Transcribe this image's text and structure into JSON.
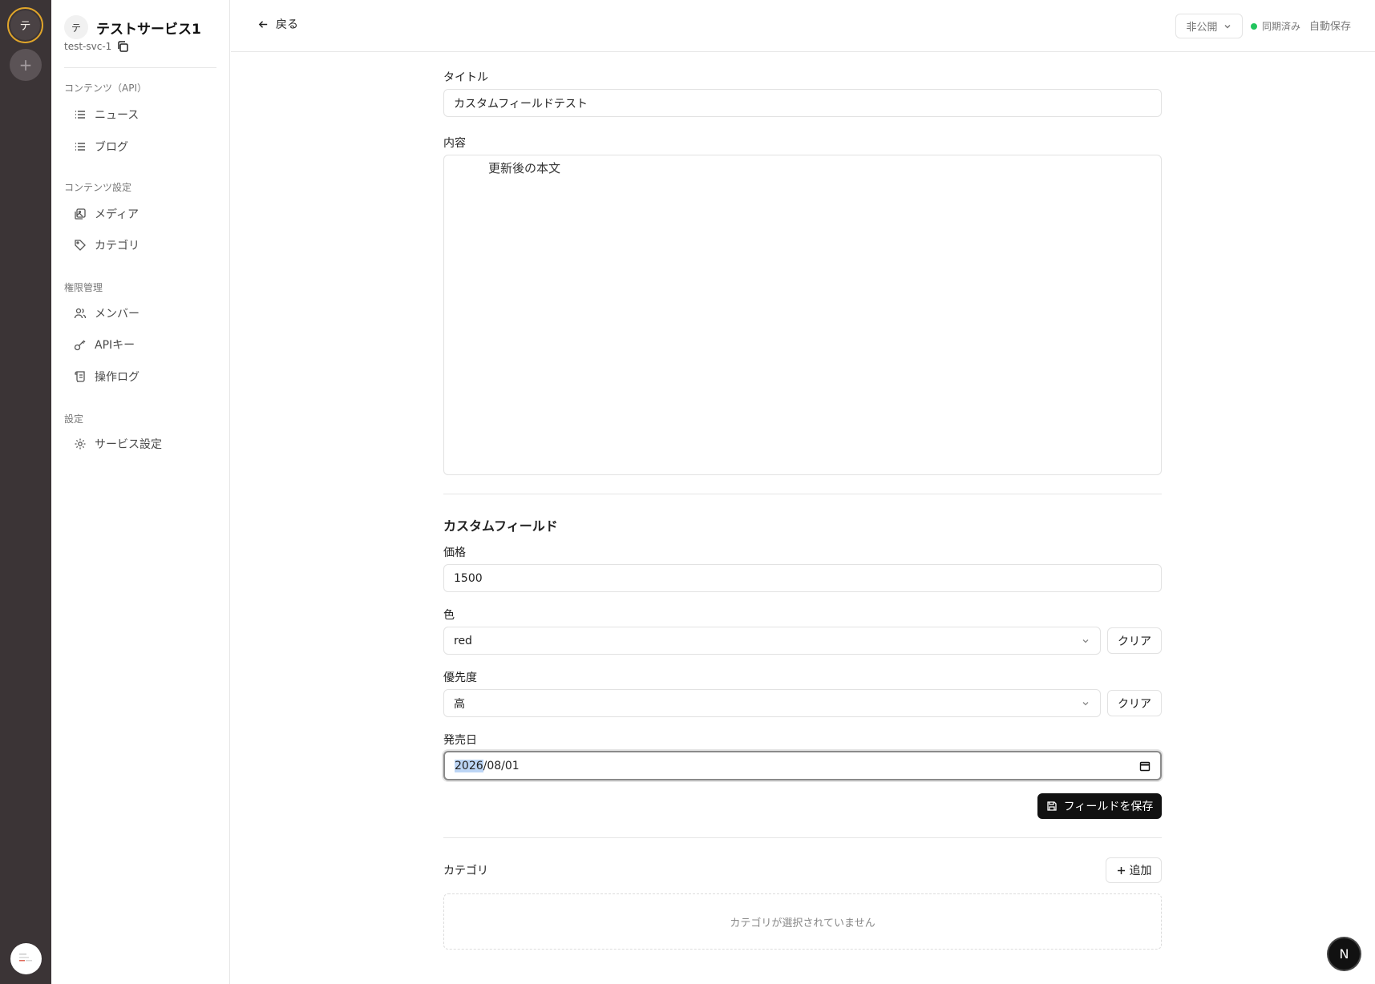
{
  "rail": {
    "service_initial": "テ",
    "add_symbol": "+"
  },
  "sidebar": {
    "service_initial": "テ",
    "service_name": "テストサービス1",
    "service_id": "test-svc-1",
    "sections": [
      {
        "label": "コンテンツ（API）"
      },
      {
        "label": "コンテンツ設定"
      },
      {
        "label": "権限管理"
      },
      {
        "label": "設定"
      }
    ],
    "items": [
      {
        "label": "ニュース",
        "icon": "list-icon"
      },
      {
        "label": "ブログ",
        "icon": "list-icon"
      },
      {
        "label": "メディア",
        "icon": "images-icon"
      },
      {
        "label": "カテゴリ",
        "icon": "tag-icon"
      },
      {
        "label": "メンバー",
        "icon": "users-icon"
      },
      {
        "label": "APIキー",
        "icon": "key-icon"
      },
      {
        "label": "操作ログ",
        "icon": "scroll-icon"
      },
      {
        "label": "サービス設定",
        "icon": "gear-icon"
      }
    ]
  },
  "topbar": {
    "back_label": "戻る",
    "visibility": "非公開",
    "sync_status": "同期済み",
    "autosave": "自動保存",
    "sync_color": "#22c55e"
  },
  "form": {
    "title_label": "タイトル",
    "title_value": "カスタムフィールドテスト",
    "content_label": "内容",
    "content_value": "更新後の本文",
    "custom_fields_heading": "カスタムフィールド",
    "price_label": "価格",
    "price_value": "1500",
    "color_label": "色",
    "color_value": "red",
    "priority_label": "優先度",
    "priority_value": "高",
    "clear_label": "クリア",
    "release_date_label": "発売日",
    "release_date_year": "2026",
    "release_date_rest": "/08/01",
    "save_fields_label": "フィールドを保存",
    "category_label": "カテゴリ",
    "add_label": "追加",
    "category_empty": "カテゴリが選択されていません"
  },
  "floating": {
    "next_badge": "N"
  }
}
